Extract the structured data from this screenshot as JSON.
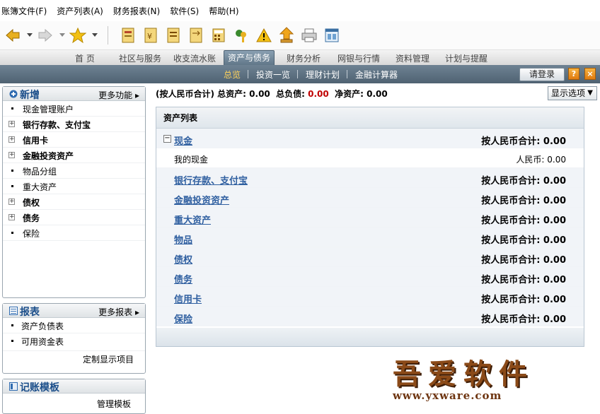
{
  "menu": [
    "账簿文件(F)",
    "资产列表(A)",
    "财务报表(N)",
    "软件(S)",
    "帮助(H)"
  ],
  "tabs": [
    "首 页",
    "社区与服务",
    "收支流水账",
    "资产与债务",
    "财务分析",
    "网银与行情",
    "资料管理",
    "计划与提醒"
  ],
  "subtabs": [
    "总览",
    "投资一览",
    "理财计划",
    "金融计算器"
  ],
  "login_label": "请登录",
  "help_label": "?",
  "close_label": "×",
  "left": {
    "new_title": "新增",
    "new_more": "更多功能",
    "items": [
      {
        "label": "现金管理账户",
        "bold": false,
        "plus": false
      },
      {
        "label": "银行存款、支付宝",
        "bold": true,
        "plus": true
      },
      {
        "label": "信用卡",
        "bold": true,
        "plus": true
      },
      {
        "label": "金融投资资产",
        "bold": true,
        "plus": true
      },
      {
        "label": "物品分组",
        "bold": false,
        "plus": false
      },
      {
        "label": "重大资产",
        "bold": false,
        "plus": false
      },
      {
        "label": "债权",
        "bold": true,
        "plus": true
      },
      {
        "label": "债务",
        "bold": true,
        "plus": true
      },
      {
        "label": "保险",
        "bold": false,
        "plus": false
      }
    ],
    "report_title": "报表",
    "report_more": "更多报表",
    "reports": [
      "资产负债表",
      "可用资金表"
    ],
    "custom_items": "定制显示项目",
    "template_title": "记账模板",
    "manage_template": "管理模板"
  },
  "summary": {
    "prefix": "(按人民币合计)",
    "assets_label": "总资产:",
    "assets": "0.00",
    "debt_label": "总负债:",
    "debt": "0.00",
    "net_label": "净资产:",
    "net": "0.00"
  },
  "display_options": "显示选项",
  "list": {
    "title": "资产列表",
    "rows": [
      {
        "name": "现金",
        "value": "按人民币合计: 0.00",
        "type": "cat",
        "expand": true
      },
      {
        "name": "我的现金",
        "value": "人民币: 0.00",
        "type": "sub"
      },
      {
        "name": "银行存款、支付宝",
        "value": "按人民币合计: 0.00",
        "type": "cat"
      },
      {
        "name": "金融投资资产",
        "value": "按人民币合计: 0.00",
        "type": "cat"
      },
      {
        "name": "重大资产",
        "value": "按人民币合计: 0.00",
        "type": "cat"
      },
      {
        "name": "物品",
        "value": "按人民币合计: 0.00",
        "type": "cat"
      },
      {
        "name": "债权",
        "value": "按人民币合计: 0.00",
        "type": "cat"
      },
      {
        "name": "债务",
        "value": "按人民币合计: 0.00",
        "type": "cat"
      },
      {
        "name": "信用卡",
        "value": "按人民币合计: 0.00",
        "type": "cat"
      },
      {
        "name": "保险",
        "value": "按人民币合计: 0.00",
        "type": "cat"
      }
    ]
  },
  "watermark": {
    "cn": "吾爱软件",
    "url": "www.yxware.com"
  },
  "colors": {
    "accent": "#2f5fa0",
    "debt_red": "#c00000",
    "active_subtab": "#ffd35a"
  }
}
